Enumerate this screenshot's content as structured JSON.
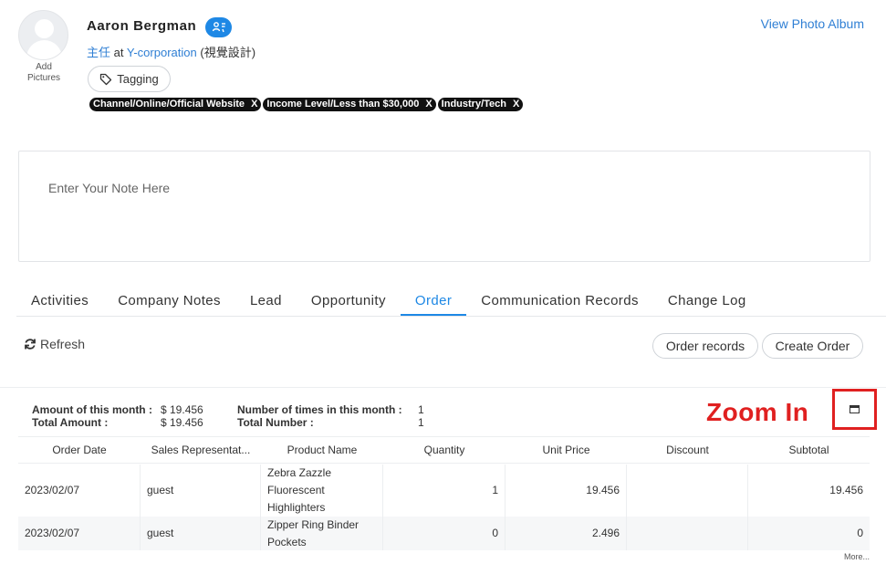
{
  "profile": {
    "name": "Aaron Bergman",
    "avatar_caption": "Add\nPictures",
    "title": "主任",
    "at": "at",
    "company": "Y-corporation",
    "department": "(視覺設計)",
    "view_album": "View Photo Album",
    "tagging_label": "Tagging",
    "badge_icon": "contact-card-icon"
  },
  "tags": [
    {
      "label": "Channel/Online/Official Website",
      "remove": "X"
    },
    {
      "label": "Income Level/Less than $30,000",
      "remove": "X"
    },
    {
      "label": "Industry/Tech",
      "remove": "X"
    }
  ],
  "note": {
    "placeholder": "Enter Your Note Here"
  },
  "tabs": [
    {
      "label": "Activities"
    },
    {
      "label": "Company Notes"
    },
    {
      "label": "Lead"
    },
    {
      "label": "Opportunity"
    },
    {
      "label": "Order",
      "active": true
    },
    {
      "label": "Communication Records"
    },
    {
      "label": "Change Log"
    }
  ],
  "toolbar": {
    "refresh_label": "Refresh",
    "order_records_label": "Order records",
    "create_order_label": "Create Order"
  },
  "summary": {
    "amount_month_label": "Amount of this month :",
    "amount_month_value": "$ 19.456",
    "total_amount_label": "Total Amount :",
    "total_amount_value": "$ 19.456",
    "times_month_label": "Number of times in this month :",
    "times_month_value": "1",
    "total_number_label": "Total Number :",
    "total_number_value": "1"
  },
  "annotation": {
    "zoom_label": "Zoom In",
    "color": "#e02020"
  },
  "table": {
    "headers": [
      "Order Date",
      "Sales Representat...",
      "Product Name",
      "Quantity",
      "Unit Price",
      "Discount",
      "Subtotal"
    ],
    "rows": [
      {
        "date": "2023/02/07",
        "rep": "guest",
        "product": "Zebra Zazzle Fluorescent Highlighters",
        "quantity": "1",
        "unit_price": "19.456",
        "discount": "",
        "subtotal": "19.456"
      },
      {
        "date": "2023/02/07",
        "rep": "guest",
        "product": "Zipper Ring Binder Pockets",
        "quantity": "0",
        "unit_price": "2.496",
        "discount": "",
        "subtotal": "0"
      }
    ],
    "more_label": "More..."
  },
  "colors": {
    "accent": "#1e88e5",
    "link": "#2f7fd4",
    "tag_bg": "#111111"
  }
}
